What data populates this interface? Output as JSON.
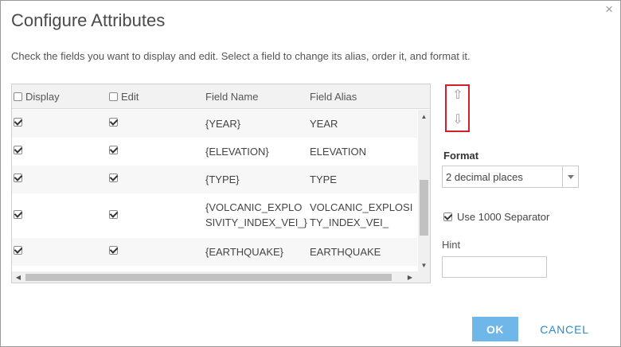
{
  "dialog": {
    "title": "Configure Attributes",
    "close_glyph": "×",
    "instructions": "Check the fields you want to display and edit. Select a field to change its alias, order it, and format it."
  },
  "grid": {
    "columns": {
      "display": "Display",
      "edit": "Edit",
      "field_name": "Field Name",
      "field_alias": "Field Alias"
    },
    "header_display_checked": false,
    "header_edit_checked": false,
    "rows": [
      {
        "display": true,
        "edit": true,
        "field_name": "{YEAR}",
        "field_alias": "YEAR"
      },
      {
        "display": true,
        "edit": true,
        "field_name": "{ELEVATION}",
        "field_alias": "ELEVATION"
      },
      {
        "display": true,
        "edit": true,
        "field_name": "{TYPE}",
        "field_alias": "TYPE"
      },
      {
        "display": true,
        "edit": true,
        "field_name_line1": "{VOLCANIC_EXPLO",
        "field_name_line2": "SIVITY_INDEX_VEI_}",
        "field_alias_line1": "VOLCANIC_EXPLOSI",
        "field_alias_line2": "TY_INDEX_VEI_"
      },
      {
        "display": true,
        "edit": true,
        "field_name": "{EARTHQUAKE}",
        "field_alias": "EARTHQUAKE"
      }
    ]
  },
  "order": {
    "up_icon": "up-arrow-icon",
    "down_icon": "down-arrow-icon"
  },
  "format": {
    "label": "Format",
    "selected": "2 decimal places"
  },
  "separator": {
    "checked": true,
    "label": "Use 1000 Separator"
  },
  "hint": {
    "label": "Hint",
    "value": ""
  },
  "buttons": {
    "ok": "OK",
    "cancel": "CANCEL"
  },
  "colors": {
    "ok_bg": "#6fb7e8",
    "cancel_text": "#2f89c9",
    "highlight_border": "#d0202a"
  }
}
